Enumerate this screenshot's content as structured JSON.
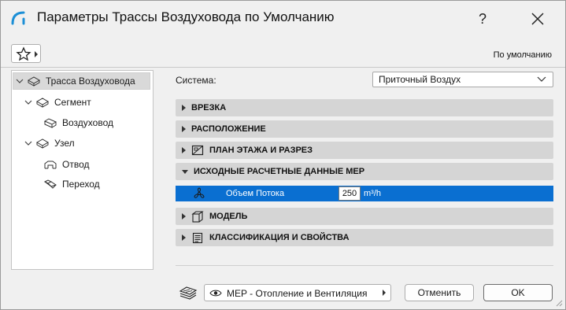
{
  "window": {
    "title": "Параметры Трассы Воздуховода по Умолчанию",
    "help_label": "?",
    "default_label": "По умолчанию"
  },
  "tree": {
    "items": [
      {
        "label": "Трасса Воздуховода",
        "icon": "duct-route-icon",
        "selected": true
      },
      {
        "label": "Сегмент",
        "icon": "segment-icon"
      },
      {
        "label": "Воздуховод",
        "icon": "duct-icon"
      },
      {
        "label": "Узел",
        "icon": "node-icon"
      },
      {
        "label": "Отвод",
        "icon": "elbow-icon"
      },
      {
        "label": "Переход",
        "icon": "transition-icon"
      }
    ]
  },
  "system": {
    "label": "Система:",
    "value": "Приточный Воздух"
  },
  "sections": [
    {
      "label": "ВРЕЗКА",
      "expanded": false
    },
    {
      "label": "РАСПОЛОЖЕНИЕ",
      "expanded": false
    },
    {
      "label": "ПЛАН ЭТАЖА И РАЗРЕЗ",
      "expanded": false,
      "icon": "floor-plan-icon"
    },
    {
      "label": "ИСХОДНЫЕ РАСЧЕТНЫЕ ДАННЫЕ MEP",
      "expanded": true
    },
    {
      "label": "МОДЕЛЬ",
      "expanded": false,
      "icon": "model-icon"
    },
    {
      "label": "КЛАССИФИКАЦИЯ И СВОЙСТВА",
      "expanded": false,
      "icon": "classification-icon"
    }
  ],
  "param": {
    "name": "Объем Потока",
    "value": "250",
    "unit": "m³/h",
    "icon": "fan-icon"
  },
  "footer": {
    "layer": "MEP - Отопление и Вентиляция",
    "cancel_label": "Отменить",
    "ok_label": "OK"
  },
  "colors": {
    "accent": "#0a6fd1",
    "section_bg": "#d5d5d5",
    "window_bg": "#f0f0f0"
  }
}
